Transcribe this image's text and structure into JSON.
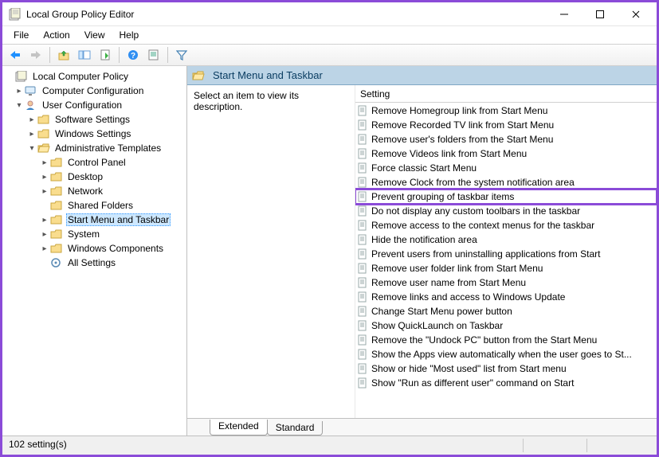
{
  "window": {
    "title": "Local Group Policy Editor"
  },
  "menu": {
    "file": "File",
    "action": "Action",
    "view": "View",
    "help": "Help"
  },
  "tree": {
    "root": "Local Computer Policy",
    "computer_cfg": "Computer Configuration",
    "user_cfg": "User Configuration",
    "soft": "Software Settings",
    "win": "Windows Settings",
    "admin": "Administrative Templates",
    "control_panel": "Control Panel",
    "desktop": "Desktop",
    "network": "Network",
    "shared_folders": "Shared Folders",
    "start_taskbar": "Start Menu and Taskbar",
    "system": "System",
    "win_components": "Windows Components",
    "all_settings": "All Settings"
  },
  "right": {
    "header": "Start Menu and Taskbar",
    "description": "Select an item to view its description.",
    "col_setting": "Setting"
  },
  "settings": [
    "Remove Homegroup link from Start Menu",
    "Remove Recorded TV link from Start Menu",
    "Remove user's folders from the Start Menu",
    "Remove Videos link from Start Menu",
    "Force classic Start Menu",
    "Remove Clock from the system notification area",
    "Prevent grouping of taskbar items",
    "Do not display any custom toolbars in the taskbar",
    "Remove access to the context menus for the taskbar",
    "Hide the notification area",
    "Prevent users from uninstalling applications from Start",
    "Remove user folder link from Start Menu",
    "Remove user name from Start Menu",
    "Remove links and access to Windows Update",
    "Change Start Menu power button",
    "Show QuickLaunch on Taskbar",
    "Remove the \"Undock PC\" button from the Start Menu",
    "Show the Apps view automatically when the user goes to St...",
    "Show or hide \"Most used\" list from Start menu",
    "Show \"Run as different user\" command on Start"
  ],
  "highlighted_index": 6,
  "tabs": {
    "extended": "Extended",
    "standard": "Standard"
  },
  "status": "102 setting(s)"
}
